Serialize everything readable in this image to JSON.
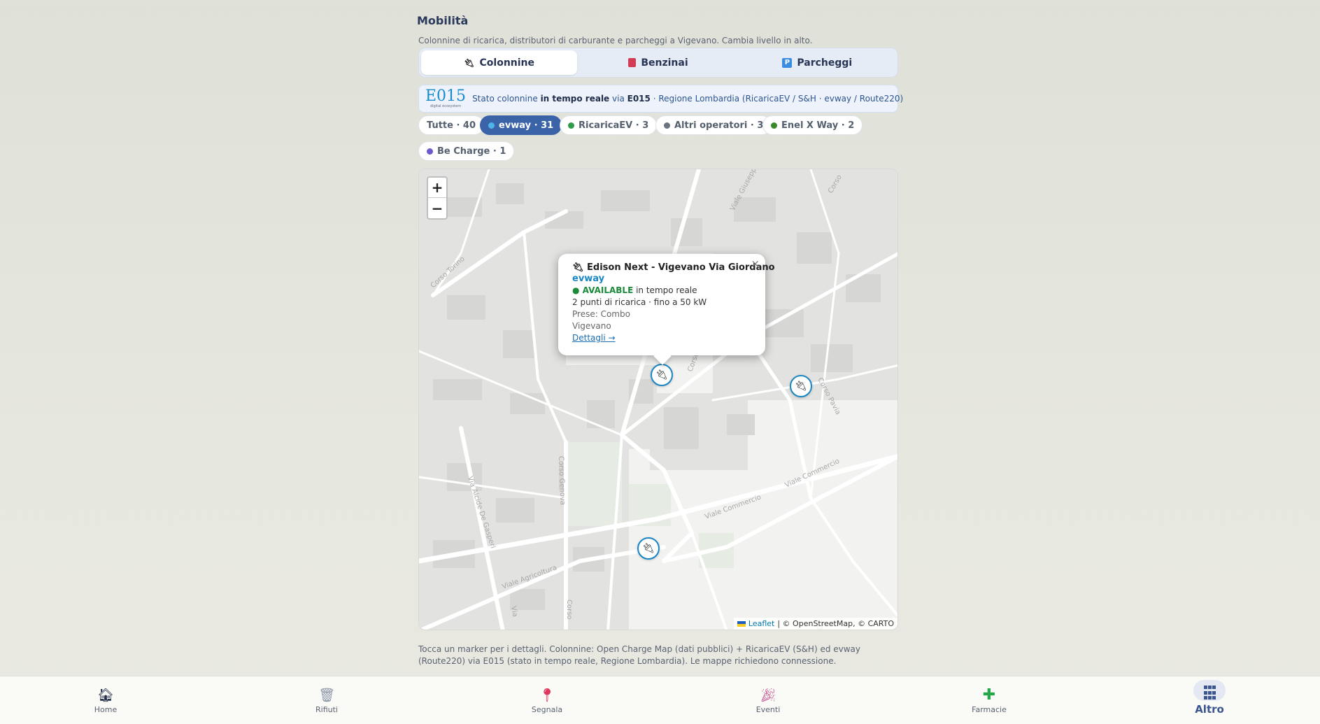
{
  "header": {
    "title": "Mobilità",
    "subtitle": "Colonnine di ricarica, distributori di carburante e parcheggi a Vigevano. Cambia livello in alto."
  },
  "tabs": [
    {
      "label": "Colonnine",
      "icon": "plug-icon",
      "active": true
    },
    {
      "label": "Benzinai",
      "icon": "fuel-pump-icon",
      "active": false
    },
    {
      "label": "Parcheggi",
      "icon": "parking-icon",
      "active": false
    }
  ],
  "banner": {
    "logo_text": "E015",
    "logo_sub": "digital ecosystem",
    "text_pre": "Stato colonnine ",
    "text_bold": "in tempo reale",
    "text_mid": " via ",
    "text_bold2": "E015",
    "text_post": " · Regione Lombardia (RicaricaEV / S&H · evway / Route220)"
  },
  "filters": [
    {
      "label": "Tutte · 40",
      "dot_color": null,
      "active": false
    },
    {
      "label": "evway · 31",
      "dot_color": "#1a87c4",
      "active": true
    },
    {
      "label": "RicaricaEV · 3",
      "dot_color": "#2e9b48",
      "active": false
    },
    {
      "label": "Altri operatori · 3",
      "dot_color": "#6b7280",
      "active": false
    },
    {
      "label": "Enel X Way · 2",
      "dot_color": "#3a8a2a",
      "active": false
    },
    {
      "label": "Be Charge · 1",
      "dot_color": "#6a5acd",
      "active": false
    }
  ],
  "map": {
    "zoom_in": "+",
    "zoom_out": "−",
    "street_labels": [
      "Corso Torino",
      "Viale Giuseppe Mazzini",
      "Corso Pavia",
      "Corso Genova",
      "Via Alcide De Gasperi",
      "Viale Commercio",
      "Viale Commercio",
      "Viale Agricoltura",
      "Corso",
      "Corso",
      "Via",
      "Corso",
      "Co"
    ],
    "popup": {
      "title": "Edison Next - Vigevano Via Giordano",
      "operator": "evway",
      "status": "● AVAILABLE",
      "status_suffix": " in tempo reale",
      "points": "2 punti di ricarica · fino a 50 kW",
      "plugs": "Prese: Combo",
      "city": "Vigevano",
      "link": "Dettagli →",
      "close": "×"
    },
    "attribution_link": "Leaflet",
    "attribution_text": "| © OpenStreetMap, © CARTO"
  },
  "footnote": "Tocca un marker per i dettagli. Colonnine: Open Charge Map (dati pubblici) + RicaricaEV (S&H) ed evway (Route220) via E015 (stato in tempo reale, Regione Lombardia). Le mappe richiedono connessione.",
  "bottom_nav": [
    {
      "label": "Home",
      "icon": "home-icon",
      "active": false
    },
    {
      "label": "Rifiuti",
      "icon": "trash-icon",
      "active": false
    },
    {
      "label": "Segnala",
      "icon": "pin-icon",
      "active": false
    },
    {
      "label": "Eventi",
      "icon": "party-icon",
      "active": false
    },
    {
      "label": "Farmacie",
      "icon": "pharmacy-cross-icon",
      "active": false
    },
    {
      "label": "Altro",
      "icon": "grid-icon",
      "active": true
    }
  ]
}
